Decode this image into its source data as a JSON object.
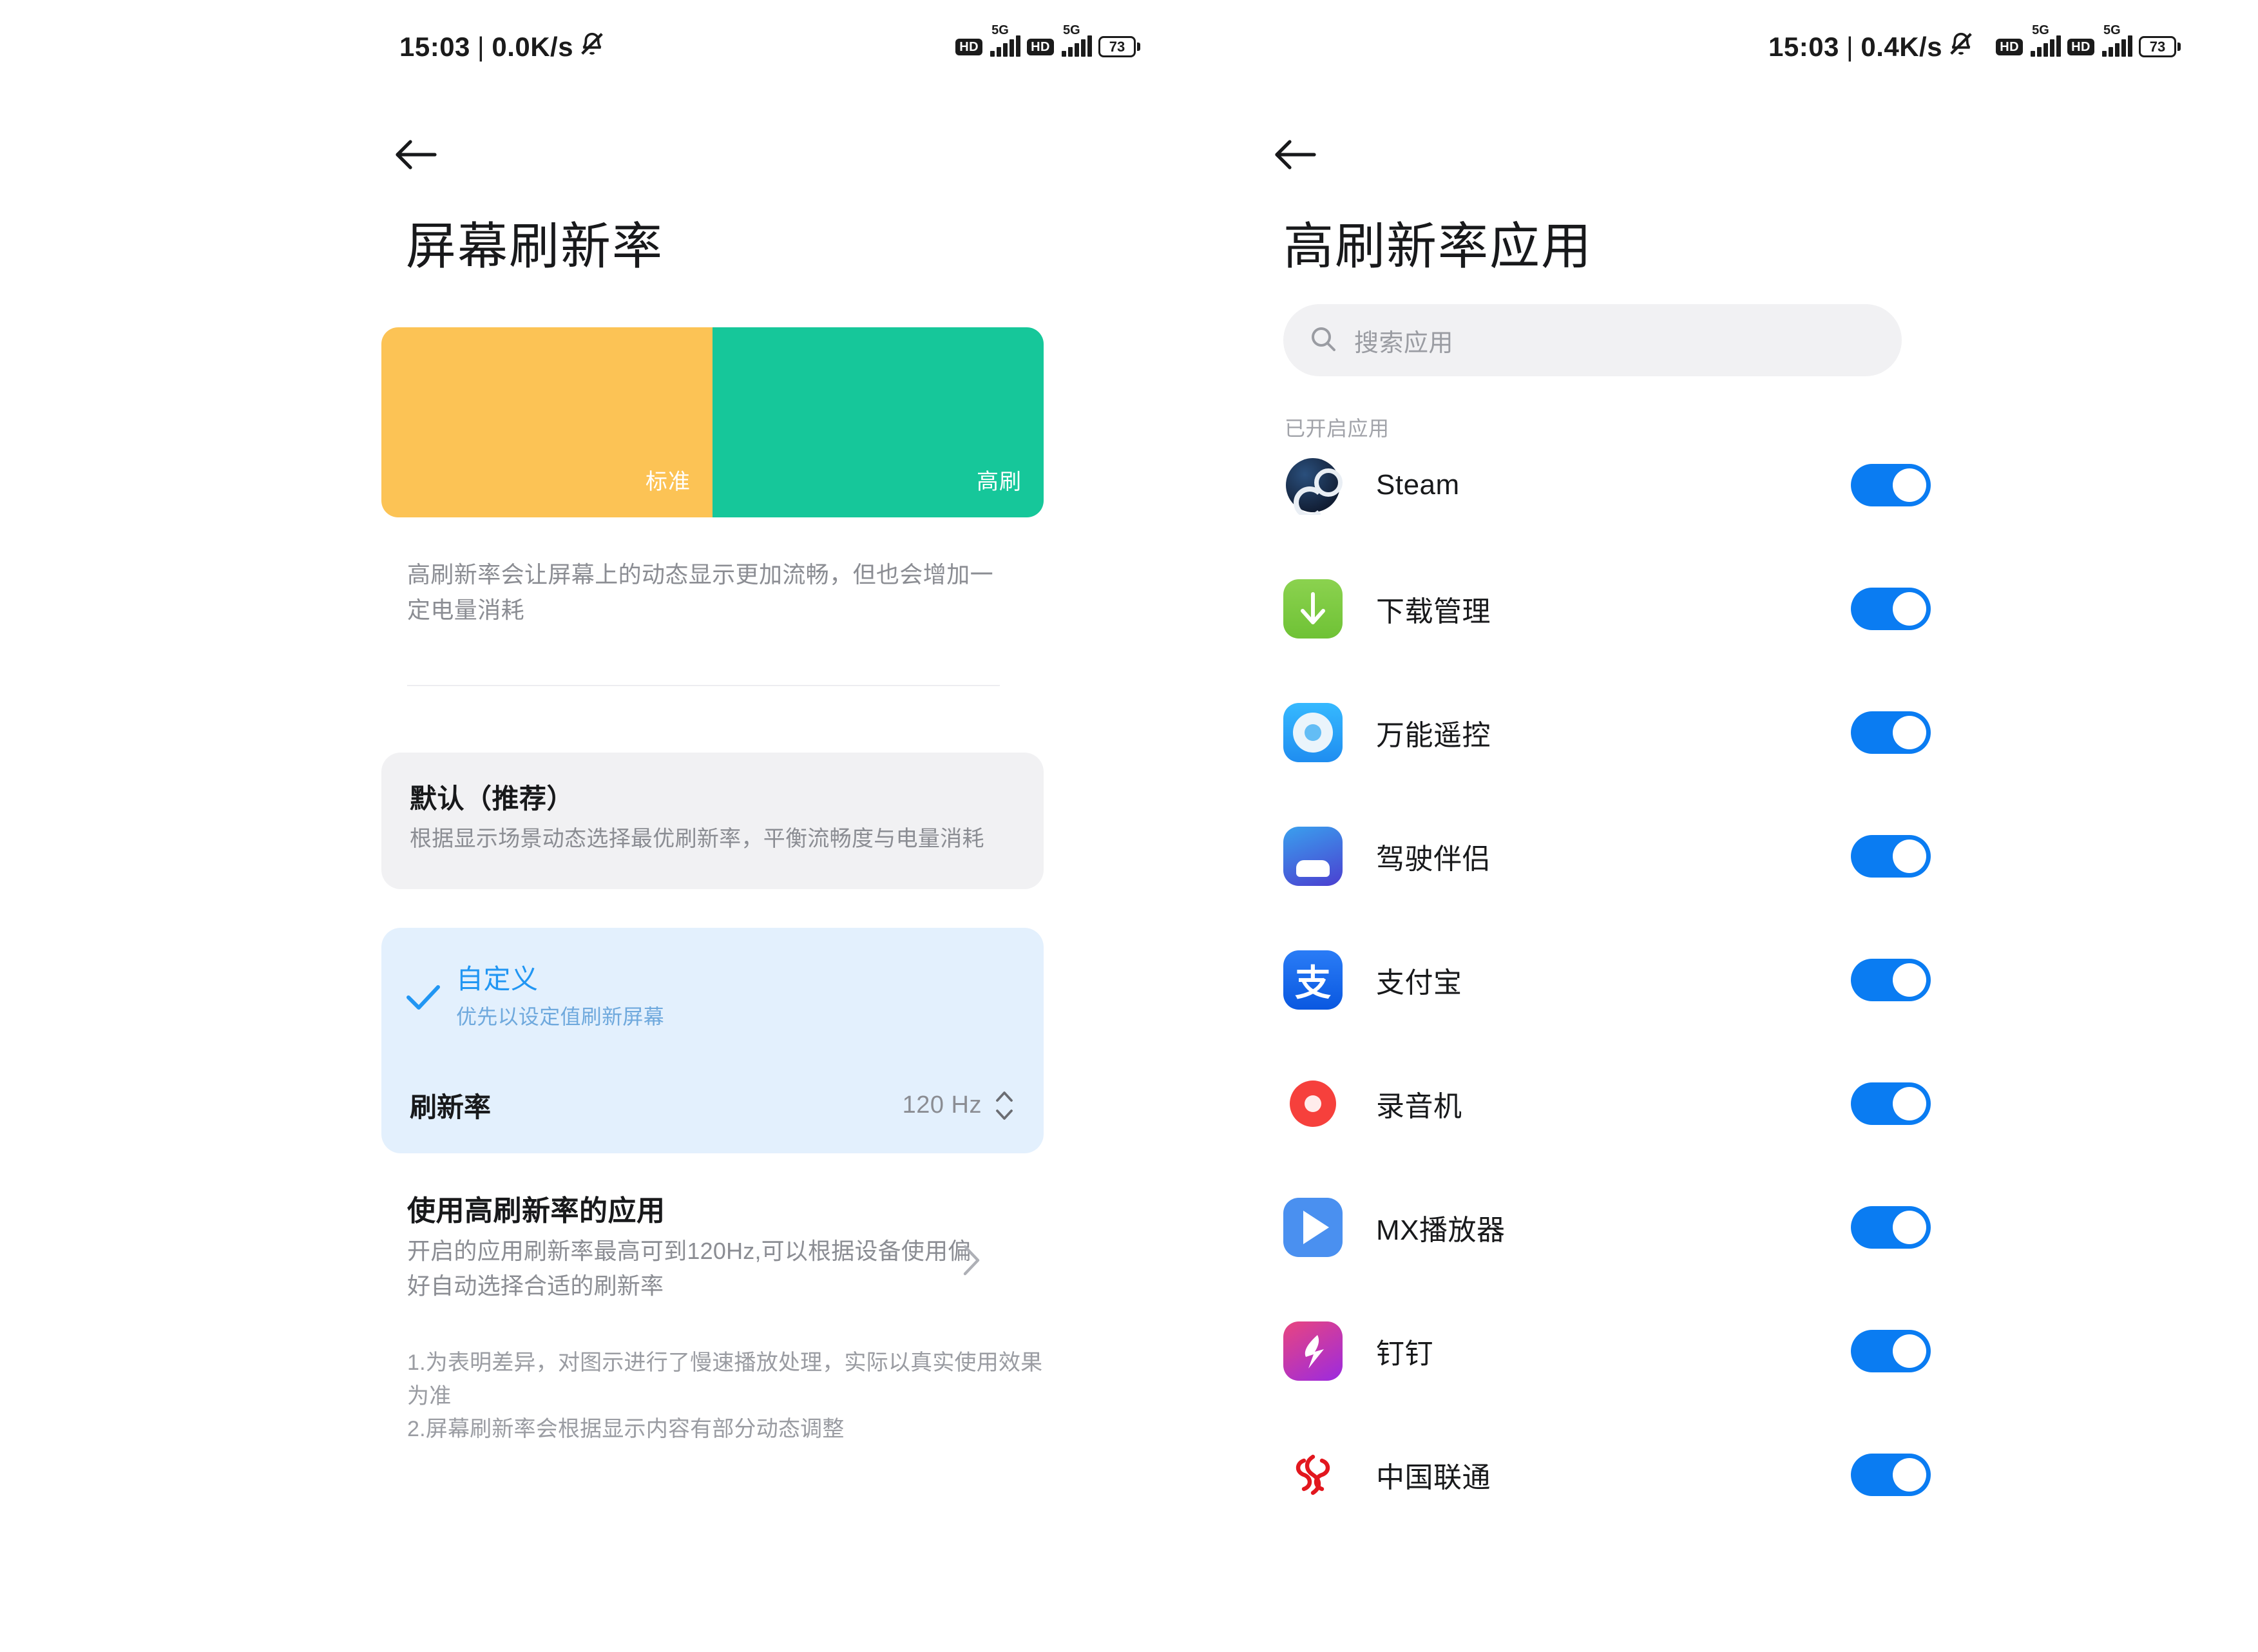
{
  "left_screen": {
    "status_bar": {
      "time": "15:03",
      "separator": "|",
      "net_speed": "0.0K/s",
      "mute_icon": "mute-bell-icon",
      "hd_badge_1": "HD",
      "network_1": "5G",
      "hd_badge_2": "HD",
      "network_2": "5G",
      "battery_percent": "73"
    },
    "back_icon": "back-arrow-icon",
    "title": "屏幕刷新率",
    "demo": {
      "standard_label": "标准",
      "high_label": "高刷",
      "standard_color": "#fcc355",
      "high_color": "#16c79a"
    },
    "description": "高刷新率会让屏幕上的动态显示更加流畅，但也会增加一定电量消耗",
    "options": [
      {
        "title": "默认（推荐）",
        "subtitle": "根据显示场景动态选择最优刷新率，平衡流畅度与电量消耗",
        "selected": false
      },
      {
        "title": "自定义",
        "subtitle": "优先以设定值刷新屏幕",
        "selected": true,
        "check_icon": "check-icon",
        "rate_label": "刷新率",
        "rate_value": "120 Hz",
        "stepper_icon": "up-down-stepper-icon"
      }
    ],
    "apps_link": {
      "title": "使用高刷新率的应用",
      "subtitle": "开启的应用刷新率最高可到120Hz,可以根据设备使用偏好自动选择合适的刷新率",
      "chevron_icon": "chevron-right-icon"
    },
    "footnotes": "1.为表明差异，对图示进行了慢速播放处理，实际以真实使用效果为准\n2.屏幕刷新率会根据显示内容有部分动态调整"
  },
  "right_screen": {
    "status_bar": {
      "time": "15:03",
      "separator": "|",
      "net_speed": "0.4K/s",
      "mute_icon": "mute-bell-icon",
      "hd_badge_1": "HD",
      "network_1": "5G",
      "hd_badge_2": "HD",
      "network_2": "5G",
      "battery_percent": "73"
    },
    "back_icon": "back-arrow-icon",
    "title": "高刷新率应用",
    "search": {
      "icon": "search-icon",
      "placeholder": "搜索应用",
      "value": ""
    },
    "section_label": "已开启应用",
    "apps": [
      {
        "name": "Steam",
        "icon": "steam-icon",
        "enabled": true
      },
      {
        "name": "下载管理",
        "icon": "download-icon",
        "enabled": true
      },
      {
        "name": "万能遥控",
        "icon": "remote-control-icon",
        "enabled": true
      },
      {
        "name": "驾驶伴侣",
        "icon": "driving-companion-icon",
        "enabled": true
      },
      {
        "name": "支付宝",
        "icon": "alipay-icon",
        "enabled": true
      },
      {
        "name": "录音机",
        "icon": "recorder-icon",
        "enabled": true
      },
      {
        "name": "MX播放器",
        "icon": "mx-player-icon",
        "enabled": true
      },
      {
        "name": "钉钉",
        "icon": "dingtalk-icon",
        "enabled": true
      },
      {
        "name": "中国联通",
        "icon": "china-unicom-icon",
        "enabled": true
      }
    ],
    "toggle_on_color": "#0a7cf2"
  }
}
